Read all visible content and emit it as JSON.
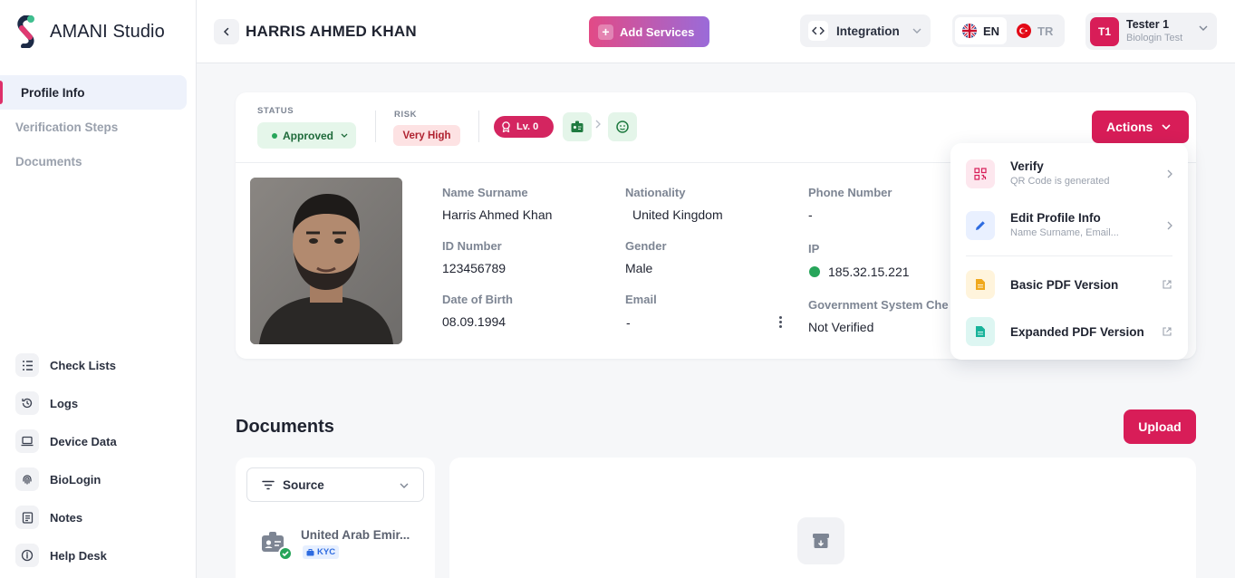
{
  "app": {
    "name": "AMANI Studio"
  },
  "sidebar": {
    "top_items": [
      {
        "label": "Profile Info",
        "active": true
      },
      {
        "label": "Verification Steps"
      },
      {
        "label": "Documents"
      }
    ],
    "bottom_items": [
      {
        "label": "Check Lists",
        "icon": "checklist-icon"
      },
      {
        "label": "Logs",
        "icon": "history-icon"
      },
      {
        "label": "Device Data",
        "icon": "laptop-icon"
      },
      {
        "label": "BioLogin",
        "icon": "fingerprint-icon"
      },
      {
        "label": "Notes",
        "icon": "notes-icon"
      },
      {
        "label": "Help Desk",
        "icon": "info-icon"
      }
    ]
  },
  "header": {
    "title": "HARRIS AHMED KHAN",
    "add_services": "Add Services",
    "integration": "Integration",
    "lang_en": "EN",
    "lang_tr": "TR",
    "user": {
      "initials": "T1",
      "name": "Tester 1",
      "subtitle": "Biologin Test"
    }
  },
  "profile": {
    "status_label": "STATUS",
    "status": "Approved",
    "risk_label": "RISK",
    "risk": "Very High",
    "level": "Lv. 0",
    "actions": "Actions",
    "fields": {
      "name_label": "Name Surname",
      "name": "Harris Ahmed Khan",
      "nationality_label": "Nationality",
      "nationality": "United Kingdom",
      "phone_label": "Phone Number",
      "phone": "-",
      "id_label": "ID Number",
      "id": "123456789",
      "gender_label": "Gender",
      "gender": "Male",
      "ip_label": "IP",
      "ip": "185.32.15.221",
      "dob_label": "Date of Birth",
      "dob": "08.09.1994",
      "email_label": "Email",
      "email": "-",
      "gov_label": "Government System Che",
      "gov": "Not Verified"
    }
  },
  "actions_menu": {
    "verify_title": "Verify",
    "verify_sub": "QR Code is generated",
    "edit_title": "Edit Profile Info",
    "edit_sub": "Name Surname, Email...",
    "basic_pdf": "Basic PDF Version",
    "expanded_pdf": "Expanded PDF Version"
  },
  "documents": {
    "title": "Documents",
    "upload": "Upload",
    "source": "Source",
    "item_name": "United Arab Emir...",
    "item_tag": "KYC"
  },
  "colors": {
    "brand": "#d81d58",
    "approved_bg": "#e5f6ea",
    "risk_bg": "#fde2e3"
  }
}
